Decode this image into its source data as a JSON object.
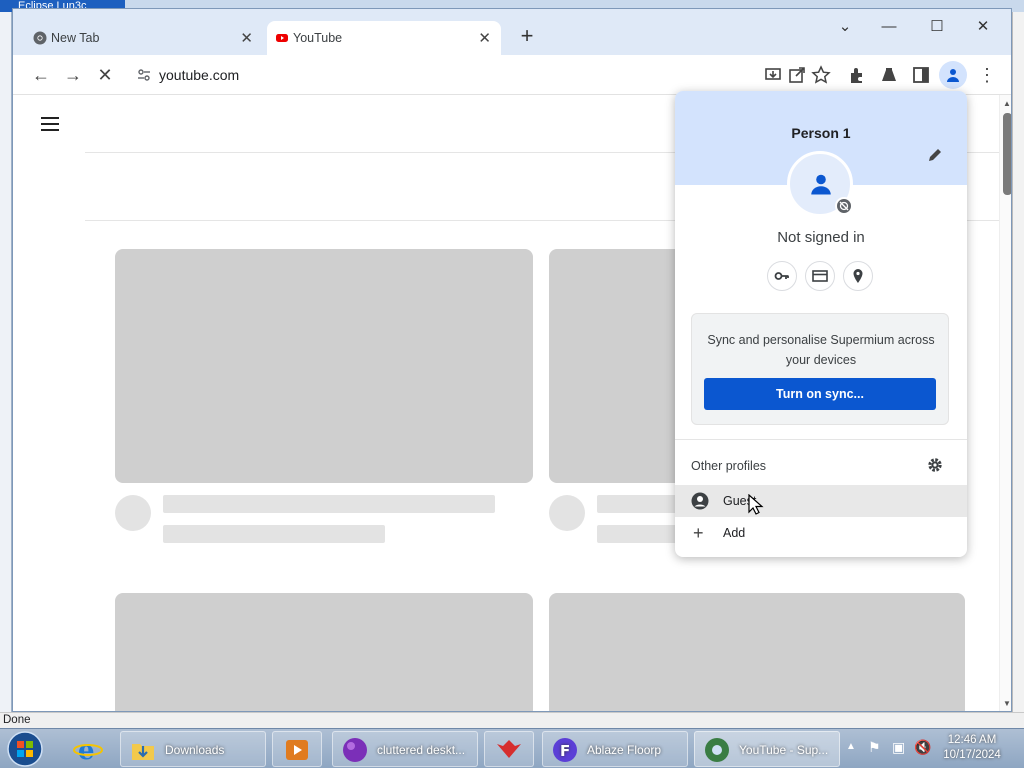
{
  "background": {
    "window_title": "Eclipse Lun3c"
  },
  "browser": {
    "tabs": [
      {
        "label": "New Tab",
        "icon": "chrome-icon"
      },
      {
        "label": "YouTube",
        "icon": "youtube-icon"
      }
    ],
    "url": "youtube.com",
    "window_controls": [
      "chevron-down-icon",
      "minimize-icon",
      "maximize-icon",
      "close-icon"
    ]
  },
  "profile_menu": {
    "name": "Person 1",
    "status": "Not signed in",
    "sync_text": "Sync and personalise Supermium across your devices",
    "sync_button": "Turn on sync...",
    "other_profiles_label": "Other profiles",
    "profiles": [
      {
        "label": "Guest"
      },
      {
        "label": "Add"
      }
    ]
  },
  "status_bar": {
    "text": "Done"
  },
  "taskbar": {
    "items": [
      {
        "label": "Downloads"
      },
      {
        "label": "cluttered deskt..."
      },
      {
        "label": "Ablaze Floorp"
      },
      {
        "label": "YouTube - Sup..."
      }
    ],
    "time": "12:46 AM",
    "date": "10/17/2024"
  },
  "colors": {
    "accent": "#0b57d0",
    "popup_header": "#d3e3fd"
  }
}
